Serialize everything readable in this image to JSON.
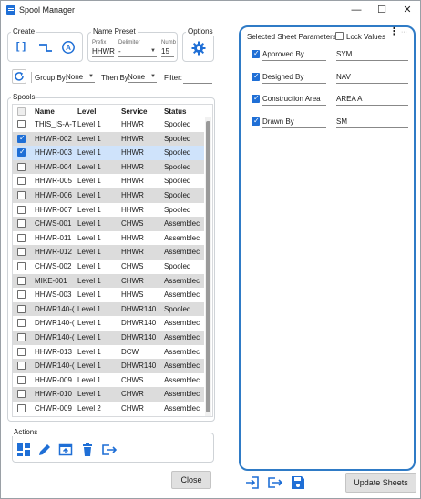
{
  "window": {
    "title": "Spool Manager",
    "controls": {
      "minimize": "—",
      "maximize": "☐",
      "close": "✕"
    }
  },
  "create": {
    "label": "Create",
    "buttons": [
      "brackets-icon",
      "connector-icon",
      "auto-create-icon"
    ]
  },
  "name_preset": {
    "label": "Name Preset",
    "prefix_label": "Prefix",
    "prefix_value": "HHWR",
    "delimiter_label": "Delimiter",
    "delimiter_value": "-",
    "number_label": "Numb",
    "number_value": "15"
  },
  "options": {
    "label": "Options",
    "icon": "gear-icon"
  },
  "toolbar": {
    "refresh_icon": "refresh-icon",
    "group_by_label": "Group By:",
    "group_by_value": "None",
    "then_by_label": "Then By:",
    "then_by_value": "None",
    "filter_label": "Filter:",
    "filter_value": ""
  },
  "spools": {
    "label": "Spools",
    "columns": [
      "Name",
      "Level",
      "Service",
      "Status"
    ],
    "rows": [
      {
        "checked": false,
        "name": "THIS_IS-A-T",
        "level": "Level 1",
        "service": "HHWR",
        "status": "Spooled"
      },
      {
        "checked": true,
        "name": "HHWR-002",
        "level": "Level 1",
        "service": "HHWR",
        "status": "Spooled"
      },
      {
        "checked": true,
        "name": "HHWR-003",
        "level": "Level 1",
        "service": "HHWR",
        "status": "Spooled"
      },
      {
        "checked": false,
        "name": "HHWR-004",
        "level": "Level 1",
        "service": "HHWR",
        "status": "Spooled"
      },
      {
        "checked": false,
        "name": "HHWR-005",
        "level": "Level 1",
        "service": "HHWR",
        "status": "Spooled"
      },
      {
        "checked": false,
        "name": "HHWR-006",
        "level": "Level 1",
        "service": "HHWR",
        "status": "Spooled"
      },
      {
        "checked": false,
        "name": "HHWR-007",
        "level": "Level 1",
        "service": "HHWR",
        "status": "Spooled"
      },
      {
        "checked": false,
        "name": "CHWS-001",
        "level": "Level 1",
        "service": "CHWS",
        "status": "Assemblec"
      },
      {
        "checked": false,
        "name": "HHWR-011",
        "level": "Level 1",
        "service": "HHWR",
        "status": "Assemblec"
      },
      {
        "checked": false,
        "name": "HHWR-012",
        "level": "Level 1",
        "service": "HHWR",
        "status": "Assemblec"
      },
      {
        "checked": false,
        "name": "CHWS-002",
        "level": "Level 1",
        "service": "CHWS",
        "status": "Spooled"
      },
      {
        "checked": false,
        "name": "MIKE-001",
        "level": "Level 1",
        "service": "CHWR",
        "status": "Assemblec"
      },
      {
        "checked": false,
        "name": "HHWS-003",
        "level": "Level 1",
        "service": "HHWS",
        "status": "Assemblec"
      },
      {
        "checked": false,
        "name": "DHWR140-(",
        "level": "Level 1",
        "service": "DHWR140",
        "status": "Spooled"
      },
      {
        "checked": false,
        "name": "DHWR140-(",
        "level": "Level 1",
        "service": "DHWR140",
        "status": "Assemblec"
      },
      {
        "checked": false,
        "name": "DHWR140-(",
        "level": "Level 1",
        "service": "DHWR140",
        "status": "Assemblec"
      },
      {
        "checked": false,
        "name": "HHWR-013",
        "level": "Level 1",
        "service": "DCW",
        "status": "Assemblec"
      },
      {
        "checked": false,
        "name": "DHWR140-(",
        "level": "Level 1",
        "service": "DHWR140",
        "status": "Assemblec"
      },
      {
        "checked": false,
        "name": "HHWR-009",
        "level": "Level 1",
        "service": "CHWS",
        "status": "Assemblec"
      },
      {
        "checked": false,
        "name": "HHWR-010",
        "level": "Level 1",
        "service": "CHWR",
        "status": "Assemblec"
      },
      {
        "checked": false,
        "name": "CHWR-009",
        "level": "Level 2",
        "service": "CHWR",
        "status": "Assemblec"
      }
    ]
  },
  "actions": {
    "label": "Actions",
    "buttons": [
      "layout-icon",
      "edit-icon",
      "open-in-new-icon",
      "delete-icon",
      "export-icon"
    ]
  },
  "close_label": "Close",
  "sheet_params": {
    "title": "Selected Sheet Parameters",
    "lock_label": "Lock Values",
    "lock_checked": false,
    "params": [
      {
        "checked": true,
        "name": "Approved By",
        "value": "SYM"
      },
      {
        "checked": true,
        "name": "Designed By",
        "value": "NAV"
      },
      {
        "checked": true,
        "name": "Construction Area",
        "value": "AREA A"
      },
      {
        "checked": true,
        "name": "Drawn By",
        "value": "SM"
      }
    ]
  },
  "bottom_icons": [
    "import-icon",
    "export-icon",
    "save-icon"
  ],
  "update_label": "Update Sheets",
  "colors": {
    "accent": "#1f6fd6",
    "panel_border": "#2f7bc6",
    "selected_row": "#cfe3fb",
    "alt_row": "#dcdcdc"
  }
}
